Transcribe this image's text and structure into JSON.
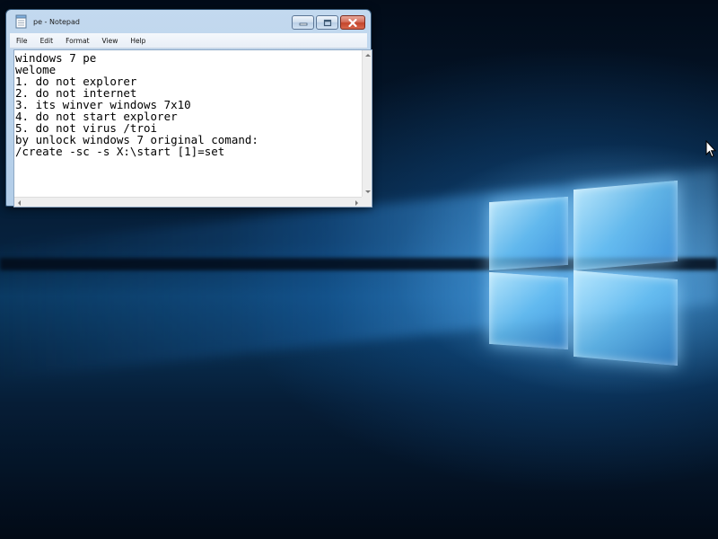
{
  "window": {
    "title": "pe - Notepad",
    "app_icon": "notepad-icon",
    "controls": {
      "minimize_icon": "minimize-icon",
      "maximize_icon": "maximize-icon",
      "close_icon": "close-icon"
    }
  },
  "menubar": {
    "items": [
      "File",
      "Edit",
      "Format",
      "View",
      "Help"
    ]
  },
  "editor": {
    "content": "windows 7 pe\nwelome\n1. do not explorer\n2. do not internet\n3. its winver windows 7x10\n4. do not start explorer\n5. do not virus /troi\nby unlock windows 7 original comand:\n/create -sc -s X:\\start [1]=set"
  },
  "desktop": {
    "wallpaper": "windows-10-logo-wallpaper",
    "accent_color": "#1e6eb9",
    "close_button_color": "#c4452b"
  },
  "cursor": {
    "icon": "mouse-pointer-icon"
  }
}
